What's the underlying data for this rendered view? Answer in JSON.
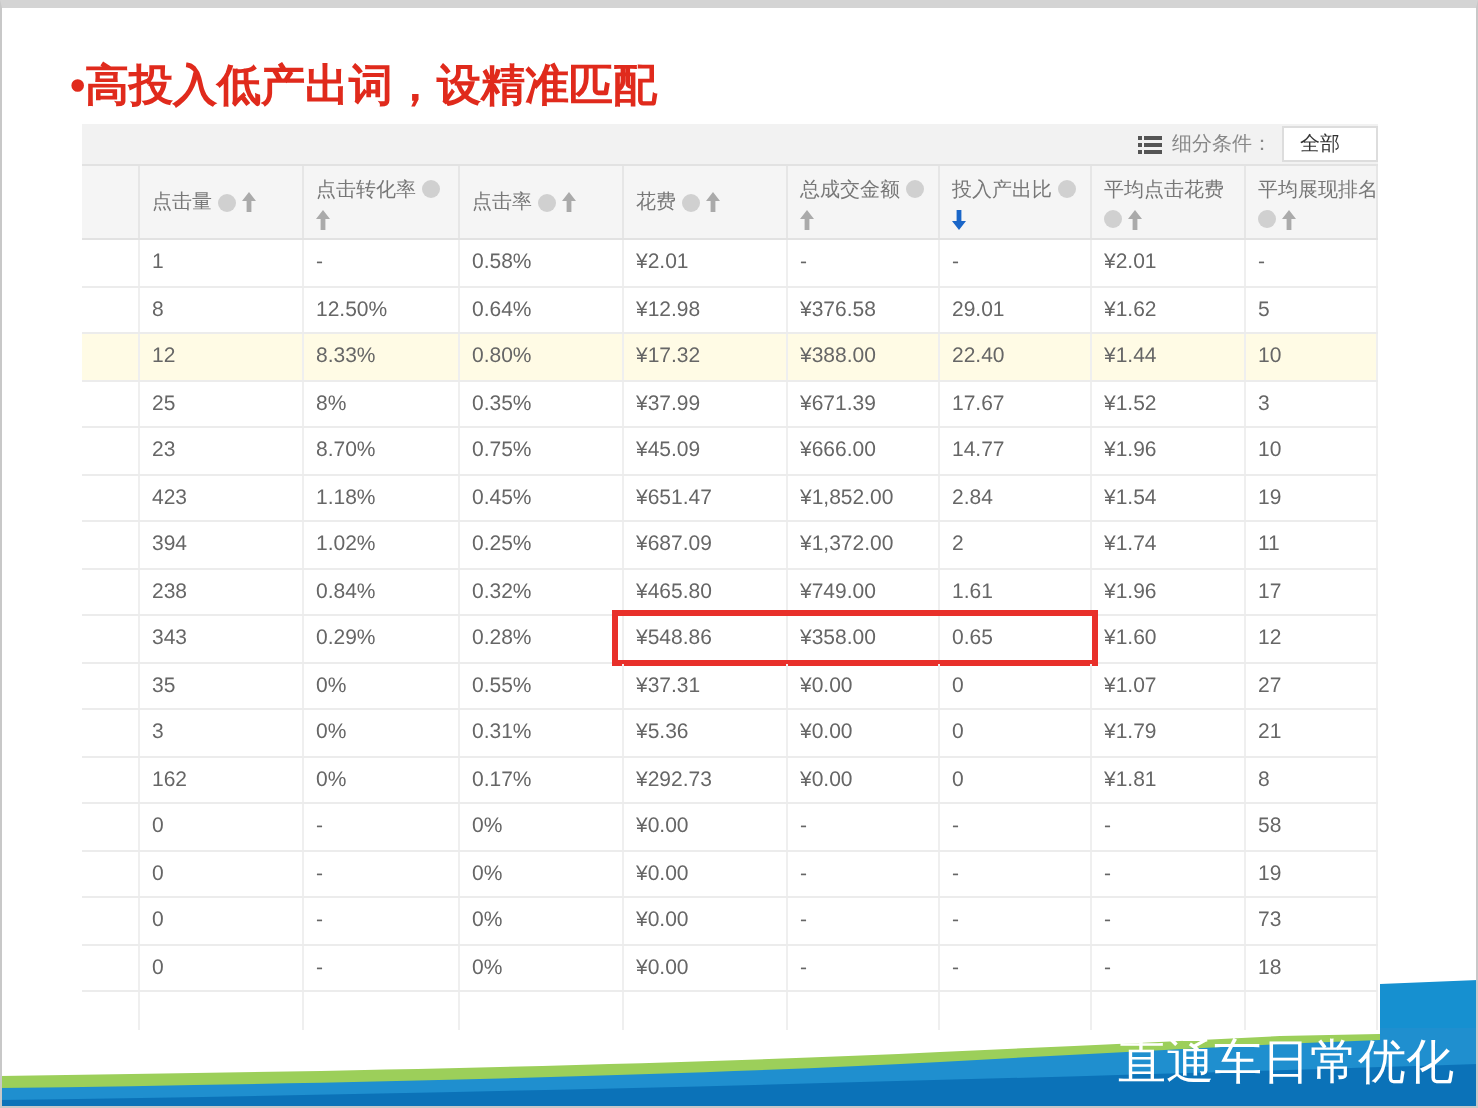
{
  "slide": {
    "title": "•高投入低产出词，设精准匹配",
    "footer_title": "直通车日常优化"
  },
  "filter": {
    "label": "细分条件：",
    "value": "全部"
  },
  "table": {
    "columns": [
      {
        "label": "点击量",
        "selected": false
      },
      {
        "label": "点击转化率",
        "selected": false
      },
      {
        "label": "点击率",
        "selected": false
      },
      {
        "label": "花费",
        "selected": false
      },
      {
        "label": "总成交金额",
        "selected": false
      },
      {
        "label": "投入产出比",
        "selected": true
      },
      {
        "label": "平均点击花费",
        "selected": false
      },
      {
        "label": "平均展现排名",
        "selected": false
      }
    ],
    "rows": [
      {
        "cells": [
          "1",
          "-",
          "0.58%",
          "¥2.01",
          "-",
          "-",
          "¥2.01",
          "-"
        ],
        "highlighted": false,
        "flagged": false
      },
      {
        "cells": [
          "8",
          "12.50%",
          "0.64%",
          "¥12.98",
          "¥376.58",
          "29.01",
          "¥1.62",
          "5"
        ],
        "highlighted": false,
        "flagged": false
      },
      {
        "cells": [
          "12",
          "8.33%",
          "0.80%",
          "¥17.32",
          "¥388.00",
          "22.40",
          "¥1.44",
          "10"
        ],
        "highlighted": true,
        "flagged": false
      },
      {
        "cells": [
          "25",
          "8%",
          "0.35%",
          "¥37.99",
          "¥671.39",
          "17.67",
          "¥1.52",
          "3"
        ],
        "highlighted": false,
        "flagged": false
      },
      {
        "cells": [
          "23",
          "8.70%",
          "0.75%",
          "¥45.09",
          "¥666.00",
          "14.77",
          "¥1.96",
          "10"
        ],
        "highlighted": false,
        "flagged": false
      },
      {
        "cells": [
          "423",
          "1.18%",
          "0.45%",
          "¥651.47",
          "¥1,852.00",
          "2.84",
          "¥1.54",
          "19"
        ],
        "highlighted": false,
        "flagged": false
      },
      {
        "cells": [
          "394",
          "1.02%",
          "0.25%",
          "¥687.09",
          "¥1,372.00",
          "2",
          "¥1.74",
          "11"
        ],
        "highlighted": false,
        "flagged": false
      },
      {
        "cells": [
          "238",
          "0.84%",
          "0.32%",
          "¥465.80",
          "¥749.00",
          "1.61",
          "¥1.96",
          "17"
        ],
        "highlighted": false,
        "flagged": false
      },
      {
        "cells": [
          "343",
          "0.29%",
          "0.28%",
          "¥548.86",
          "¥358.00",
          "0.65",
          "¥1.60",
          "12"
        ],
        "highlighted": false,
        "flagged": true
      },
      {
        "cells": [
          "35",
          "0%",
          "0.55%",
          "¥37.31",
          "¥0.00",
          "0",
          "¥1.07",
          "27"
        ],
        "highlighted": false,
        "flagged": false
      },
      {
        "cells": [
          "3",
          "0%",
          "0.31%",
          "¥5.36",
          "¥0.00",
          "0",
          "¥1.79",
          "21"
        ],
        "highlighted": false,
        "flagged": false
      },
      {
        "cells": [
          "162",
          "0%",
          "0.17%",
          "¥292.73",
          "¥0.00",
          "0",
          "¥1.81",
          "8"
        ],
        "highlighted": false,
        "flagged": false
      },
      {
        "cells": [
          "0",
          "-",
          "0%",
          "¥0.00",
          "-",
          "-",
          "-",
          "58"
        ],
        "highlighted": false,
        "flagged": false
      },
      {
        "cells": [
          "0",
          "-",
          "0%",
          "¥0.00",
          "-",
          "-",
          "-",
          "19"
        ],
        "highlighted": false,
        "flagged": false
      },
      {
        "cells": [
          "0",
          "-",
          "0%",
          "¥0.00",
          "-",
          "-",
          "-",
          "73"
        ],
        "highlighted": false,
        "flagged": false
      },
      {
        "cells": [
          "0",
          "-",
          "0%",
          "¥0.00",
          "-",
          "-",
          "-",
          "18"
        ],
        "highlighted": false,
        "flagged": false
      }
    ]
  }
}
